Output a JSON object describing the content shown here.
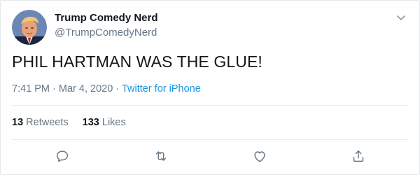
{
  "author": {
    "name": "Trump Comedy Nerd",
    "handle": "@TrumpComedyNerd",
    "avatar_icon": "profile-avatar"
  },
  "tweet": {
    "text": "PHIL HARTMAN WAS THE GLUE!",
    "time": "7:41 PM",
    "date": "Mar 4, 2020",
    "source": "Twitter for iPhone",
    "separator": "·"
  },
  "stats": {
    "retweets_count": "13",
    "retweets_label": "Retweets",
    "likes_count": "133",
    "likes_label": "Likes"
  },
  "actions": {
    "reply_icon": "reply-icon",
    "retweet_icon": "retweet-icon",
    "like_icon": "heart-icon",
    "share_icon": "share-icon"
  },
  "colors": {
    "link": "#1b95e0",
    "secondary_text": "#657786",
    "primary_text": "#14171a",
    "border": "#e6ecf0"
  }
}
